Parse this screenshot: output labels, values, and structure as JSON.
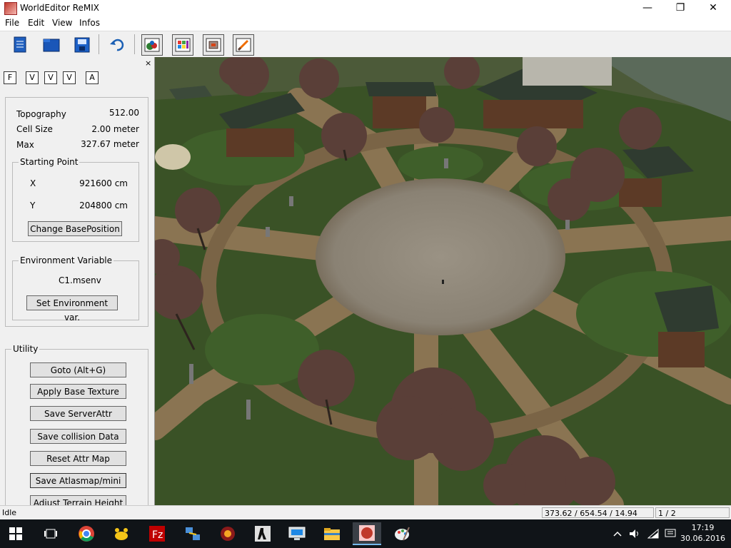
{
  "window": {
    "title": "WorldEditor ReMIX",
    "minimize": "—",
    "maximize": "❐",
    "close": "✕"
  },
  "menu": [
    "File",
    "Edit",
    "View",
    "Infos"
  ],
  "toolbar": {
    "icons": [
      "new-doc-icon",
      "open-folder-icon",
      "save-icon",
      "undo-icon",
      "terrain-icon",
      "texture-icon",
      "attribute-icon",
      "brush-icon"
    ]
  },
  "panel": {
    "close": "×",
    "tabs": [
      "F",
      "V",
      "V",
      "V",
      "A"
    ],
    "topography_label": "Topography",
    "topography_value": "512.00",
    "cellsize_label": "Cell Size",
    "cellsize_value": "2.00 meter",
    "max_label": "Max",
    "max_value": "327.67 meter",
    "starting_point": {
      "legend": "Starting Point",
      "x_label": "X",
      "x_value": "921600 cm",
      "y_label": "Y",
      "y_value": "204800 cm",
      "button": "Change BasePosition"
    },
    "environment": {
      "legend": "Environment Variable",
      "value": "C1.msenv",
      "button": "Set Environment var."
    },
    "utility": {
      "legend": "Utility",
      "buttons": [
        "Goto (Alt+G)",
        "Apply Base Texture",
        "Save ServerAttr",
        "Save collision Data",
        "Reset Attr Map",
        "Save Atlasmap/mini",
        "Adjust Terrain Height"
      ]
    }
  },
  "status": {
    "state": "Idle",
    "coords": "373.62 / 654.54 / 14.94",
    "page": "1 / 2"
  },
  "taskbar": {
    "time": "17:19",
    "date": "30.06.2016"
  },
  "colors": {
    "grass": "#3d5a28",
    "path": "#8a7452",
    "plaza": "#8e8779",
    "roof": "#2f3b30",
    "tree": "#5a3f38"
  }
}
